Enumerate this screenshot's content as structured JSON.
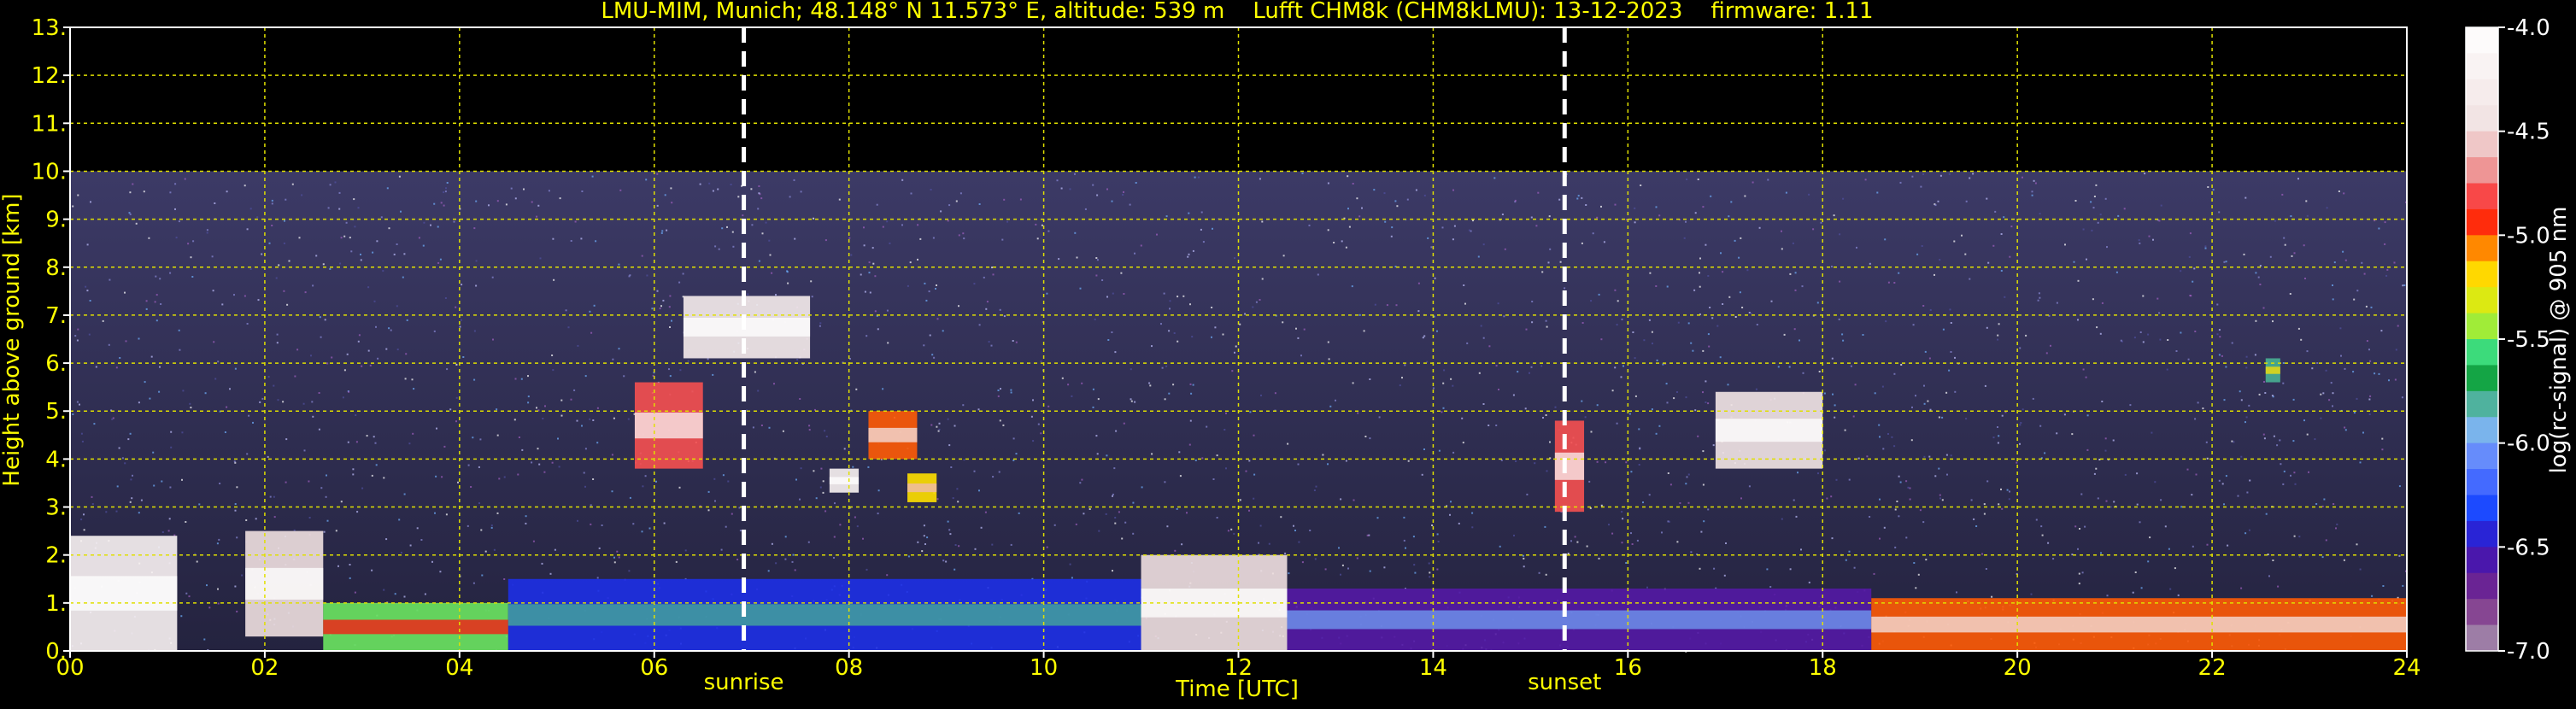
{
  "chart_data": {
    "type": "heatmap",
    "title": "LMU-MIM, Munich; 48.148° N 11.573° E, altitude: 539 m    Lufft CHM8k (CHM8kLMU): 13-12-2023    firmware: 1.11",
    "xlabel": "Time [UTC]",
    "ylabel": "Height above ground [km]",
    "colorbar_label": "log(rc-signal) @ 905 nm",
    "xlim": [
      0,
      24
    ],
    "ylim": [
      0,
      13
    ],
    "clim": [
      -7.0,
      -4.0
    ],
    "x_ticks": [
      0,
      2,
      4,
      6,
      8,
      10,
      12,
      14,
      16,
      18,
      20,
      22,
      24
    ],
    "x_tick_labels": [
      "00",
      "02",
      "04",
      "06",
      "08",
      "10",
      "12",
      "14",
      "16",
      "18",
      "20",
      "22",
      "24"
    ],
    "y_ticks": [
      0,
      1,
      2,
      3,
      4,
      5,
      6,
      7,
      8,
      9,
      10,
      11,
      12,
      13
    ],
    "y_tick_labels": [
      "0.",
      "1.",
      "2.",
      "3.",
      "4.",
      "5.",
      "6.",
      "7.",
      "8.",
      "9.",
      "10.",
      "11.",
      "12.",
      "13."
    ],
    "colorbar_ticks": [
      -4.0,
      -4.5,
      -5.0,
      -5.5,
      -6.0,
      -6.5,
      -7.0
    ],
    "colorbar_tick_labels": [
      "-4.0",
      "-4.5",
      "-5.0",
      "-5.5",
      "-6.0",
      "-6.5",
      "-7.0"
    ],
    "grid": true,
    "measurement_max_height_km": 10.0,
    "markers": [
      {
        "label": "sunrise",
        "time_utc": 6.92
      },
      {
        "label": "sunset",
        "time_utc": 15.35
      }
    ],
    "features": [
      {
        "t0": 0.0,
        "t1": 1.1,
        "h0": 0.0,
        "h1": 2.4,
        "level": -4.2
      },
      {
        "t0": 1.8,
        "t1": 2.6,
        "h0": 0.3,
        "h1": 2.5,
        "level": -4.5
      },
      {
        "t0": 2.6,
        "t1": 4.5,
        "h0": 0.0,
        "h1": 1.0,
        "level": -5.5
      },
      {
        "t0": 4.5,
        "t1": 11.0,
        "h0": 0.0,
        "h1": 1.5,
        "level": -6.4
      },
      {
        "t0": 11.0,
        "t1": 12.5,
        "h0": 0.0,
        "h1": 2.0,
        "level": -4.5
      },
      {
        "t0": 12.5,
        "t1": 18.5,
        "h0": 0.0,
        "h1": 1.3,
        "level": -6.6
      },
      {
        "t0": 18.5,
        "t1": 24.0,
        "h0": 0.0,
        "h1": 1.1,
        "level": -5.0
      },
      {
        "t0": 5.8,
        "t1": 6.5,
        "h0": 3.8,
        "h1": 5.6,
        "level": -4.8
      },
      {
        "t0": 6.3,
        "t1": 7.6,
        "h0": 6.1,
        "h1": 7.4,
        "level": -4.3
      },
      {
        "t0": 8.2,
        "t1": 8.7,
        "h0": 4.0,
        "h1": 5.0,
        "level": -5.0
      },
      {
        "t0": 7.8,
        "t1": 8.1,
        "h0": 3.3,
        "h1": 3.8,
        "level": -4.2
      },
      {
        "t0": 8.6,
        "t1": 8.9,
        "h0": 3.1,
        "h1": 3.7,
        "level": -5.2
      },
      {
        "t0": 15.25,
        "t1": 15.55,
        "h0": 2.9,
        "h1": 4.8,
        "level": -4.8
      },
      {
        "t0": 16.9,
        "t1": 18.0,
        "h0": 3.8,
        "h1": 5.4,
        "level": -4.4
      },
      {
        "t0": 22.55,
        "t1": 22.7,
        "h0": 5.6,
        "h1": 6.1,
        "level": -5.8
      }
    ]
  }
}
